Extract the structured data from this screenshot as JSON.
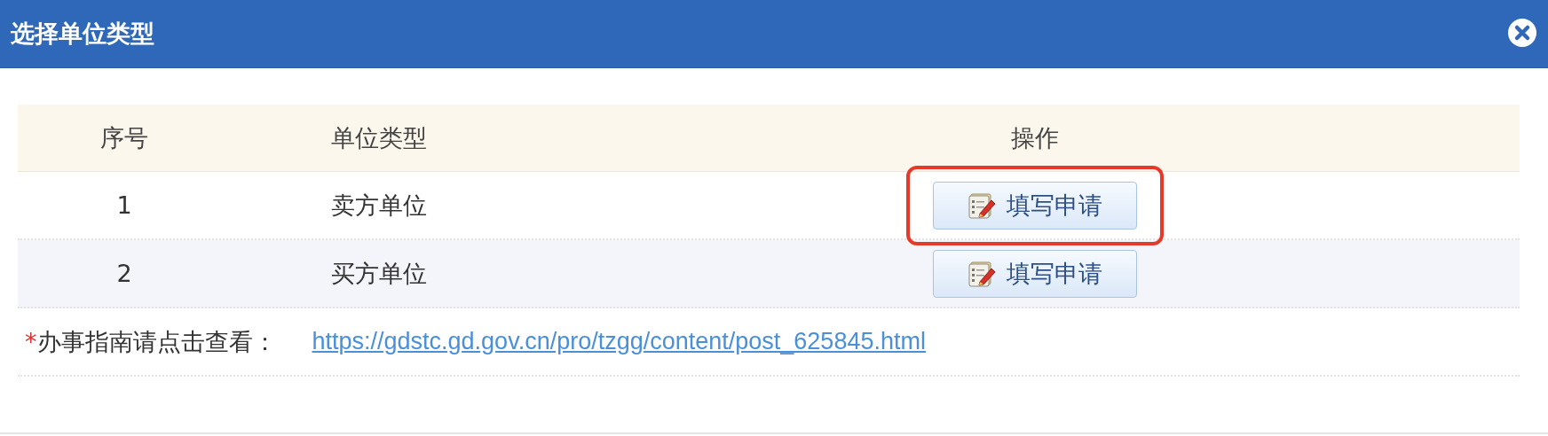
{
  "window": {
    "title": "选择单位类型"
  },
  "table": {
    "columns": [
      "序号",
      "单位类型",
      "操作"
    ],
    "rows": [
      {
        "index": "1",
        "type": "卖方单位",
        "action": "填写申请",
        "highlighted": true
      },
      {
        "index": "2",
        "type": "买方单位",
        "action": "填写申请",
        "highlighted": false
      }
    ]
  },
  "note": {
    "required_mark": "*",
    "label": "办事指南请点击查看：",
    "link": "https://gdstc.gd.gov.cn/pro/tzgg/content/post_625845.html"
  }
}
